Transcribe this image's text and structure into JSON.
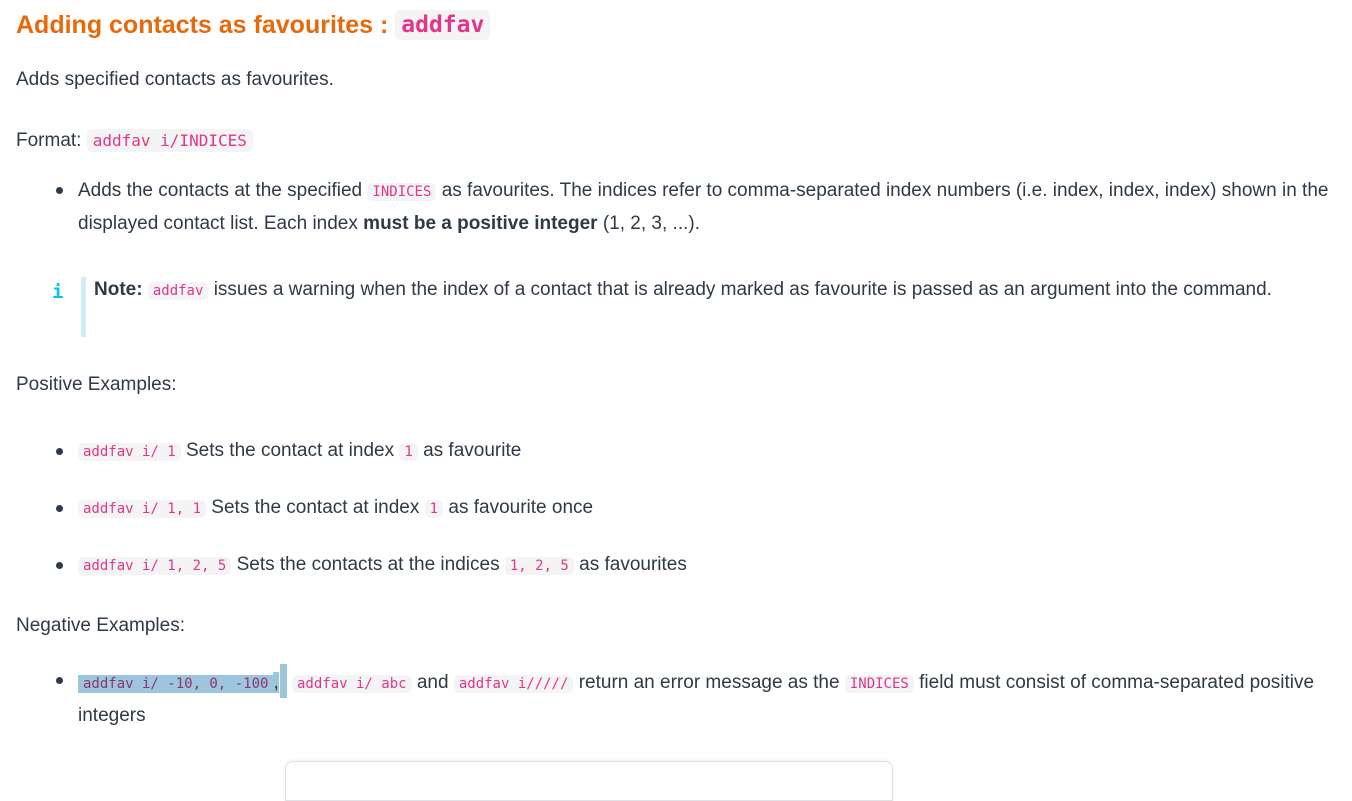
{
  "heading": {
    "title": "Adding contacts as favourites :",
    "command": "addfav"
  },
  "intro": "Adds specified contacts as favourites.",
  "format": {
    "label": "Format:",
    "syntax": "addfav i/INDICES"
  },
  "description_bullet": {
    "part1": "Adds the contacts at the specified",
    "code": "INDICES",
    "part2": "as favourites. The indices refer to comma-separated index numbers (i.e. index, index, index) shown in the displayed contact list. Each index",
    "bold": "must be a positive integer",
    "part3": "(1, 2, 3, ...)."
  },
  "note": {
    "icon": "i",
    "label": "Note:",
    "code": "addfav",
    "text": "issues a warning when the index of a contact that is already marked as favourite is passed as an argument into the command."
  },
  "positive": {
    "heading": "Positive Examples:",
    "items": [
      {
        "command": "addfav i/ 1",
        "text_before": "Sets the contact at index",
        "index": "1",
        "text_after": "as favourite"
      },
      {
        "command": "addfav i/ 1, 1",
        "text_before": "Sets the contact at index",
        "index": "1",
        "text_after": "as favourite once"
      },
      {
        "command": "addfav i/ 1, 2, 5",
        "text_before": "Sets the contacts at the indices",
        "index": "1, 2, 5",
        "text_after": "as favourites"
      }
    ]
  },
  "negative": {
    "heading": "Negative Examples:",
    "selected_command": "addfav i/ -10, 0, -100",
    "separator": ",",
    "command2": "addfav i/ abc",
    "conjunction": "and",
    "command3": "addfav i/////",
    "text_before": "return an error message as the",
    "field_code": "INDICES",
    "text_after": "field must consist of comma-separated positive integers"
  },
  "colors": {
    "heading": "#e8690b",
    "code_text": "#e0368c",
    "code_bg": "#f4f4f5",
    "body_text": "#2e3a47",
    "note_icon": "#06c3f0",
    "note_bar": "#cfecf8",
    "selection": "#9ec5de"
  }
}
